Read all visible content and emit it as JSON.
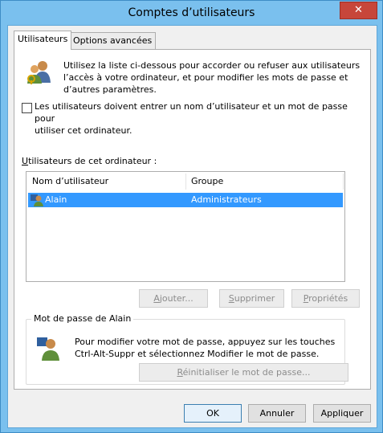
{
  "window": {
    "title": "Comptes d’utilisateurs",
    "close_label": "✕"
  },
  "tabs": [
    {
      "label": "Utilisateurs"
    },
    {
      "label": "Options avancées"
    }
  ],
  "intro": {
    "line1": "Utilisez la liste ci-dessous pour accorder ou refuser aux utilisateurs",
    "line2": "l’accès à votre ordinateur, et pour modifier les mots de passe et",
    "line3": "d’autres paramètres."
  },
  "require_login": {
    "checked": false,
    "line1": "Les utilisateurs doivent entrer un nom d’utilisateur et un mot de passe pour",
    "line2": "utiliser cet ordinateur."
  },
  "users_section": {
    "label_first": "U",
    "label_rest": "tilisateurs de cet ordinateur :",
    "columns": [
      "Nom d’utilisateur",
      "Groupe"
    ],
    "rows": [
      {
        "name": "Alain",
        "group": "Administrateurs"
      }
    ]
  },
  "user_buttons": {
    "add_first": "A",
    "add_rest": "jouter...",
    "remove_first": "S",
    "remove_rest": "upprimer",
    "props_first": "P",
    "props_rest": "ropriétés"
  },
  "password_group": {
    "legend": "Mot de passe de Alain",
    "line1": "Pour modifier votre mot de passe, appuyez sur les touches",
    "line2": "Ctrl-Alt-Suppr et sélectionnez Modifier le mot de passe.",
    "reset_first": "R",
    "reset_rest": "éinitialiser le mot de passe..."
  },
  "footer": {
    "ok": "OK",
    "cancel": "Annuler",
    "apply": "Appliquer"
  },
  "colors": {
    "accent": "#7ac0ee",
    "selection": "#3399ff",
    "close": "#c7463a"
  }
}
